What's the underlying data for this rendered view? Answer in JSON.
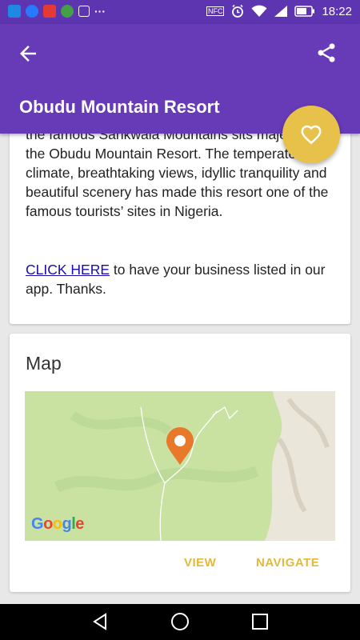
{
  "status_bar": {
    "time": "18:22",
    "nfc_label": "NFC",
    "left_icons": [
      "messenger-icon",
      "messenger-icon",
      "youtube-icon",
      "whatsapp-icon",
      "gallery-icon",
      "more-dots-icon"
    ],
    "right_icons": [
      "nfc-icon",
      "alarm-icon",
      "wifi-icon",
      "signal-icon",
      "battery-icon"
    ],
    "overflow_dots": "···"
  },
  "app_bar": {
    "title": "Obudu Mountain Resort",
    "color": "#673ab7",
    "back_icon": "arrow-back-icon",
    "share_icon": "share-icon"
  },
  "favorite_fab": {
    "icon": "heart-outline-icon",
    "color": "#e8c14a"
  },
  "description": {
    "text": "the famous Sankwala Mountains sits majestically the Obudu Mountain Resort. The temperate climate, breathtaking views, idyllic tranquility and beautiful scenery has made this resort one of the famous tourists’ sites in Nigeria.",
    "cta_link": "CLICK HERE",
    "cta_rest": " to have your business listed in our app. Thanks."
  },
  "map_card": {
    "heading": "Map",
    "map_provider_logo": "Google",
    "marker_icon": "map-pin-icon",
    "view_label": "VIEW",
    "navigate_label": "NAVIGATE",
    "accent": "#e2b93b"
  },
  "nav_bar": {
    "icons": [
      "back-triangle-icon",
      "home-circle-icon",
      "recents-square-icon"
    ]
  }
}
